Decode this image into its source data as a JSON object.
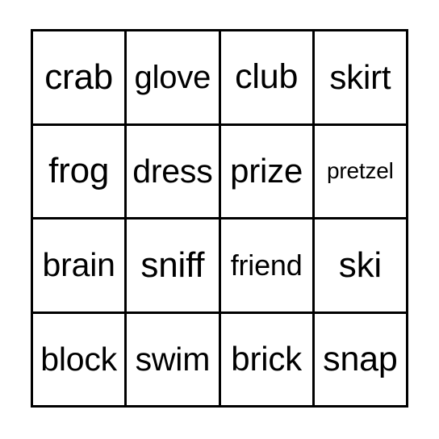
{
  "card": {
    "type": "bingo-card",
    "columns": 4,
    "rows": 4,
    "background_color": "#ffffff",
    "line_color": "#000000",
    "text_color": "#000000",
    "cells": [
      {
        "word": "crab",
        "row": 1,
        "col": 1,
        "size_class": "fs-44"
      },
      {
        "word": "glove",
        "row": 1,
        "col": 2,
        "size_class": "fs-40"
      },
      {
        "word": "club",
        "row": 1,
        "col": 3,
        "size_class": "fs-43"
      },
      {
        "word": "skirt",
        "row": 1,
        "col": 4,
        "size_class": "fs-42"
      },
      {
        "word": "frog",
        "row": 2,
        "col": 1,
        "size_class": "fs-44"
      },
      {
        "word": "dress",
        "row": 2,
        "col": 2,
        "size_class": "fs-41"
      },
      {
        "word": "prize",
        "row": 2,
        "col": 3,
        "size_class": "fs-42"
      },
      {
        "word": "pretzel",
        "row": 2,
        "col": 4,
        "size_class": "fs-28"
      },
      {
        "word": "brain",
        "row": 3,
        "col": 1,
        "size_class": "fs-41"
      },
      {
        "word": "sniff",
        "row": 3,
        "col": 2,
        "size_class": "fs-44"
      },
      {
        "word": "friend",
        "row": 3,
        "col": 3,
        "size_class": "fs-36"
      },
      {
        "word": "ski",
        "row": 3,
        "col": 4,
        "size_class": "fs-44"
      },
      {
        "word": "block",
        "row": 4,
        "col": 1,
        "size_class": "fs-41"
      },
      {
        "word": "swim",
        "row": 4,
        "col": 2,
        "size_class": "fs-41"
      },
      {
        "word": "brick",
        "row": 4,
        "col": 3,
        "size_class": "fs-42"
      },
      {
        "word": "snap",
        "row": 4,
        "col": 4,
        "size_class": "fs-43"
      }
    ]
  }
}
